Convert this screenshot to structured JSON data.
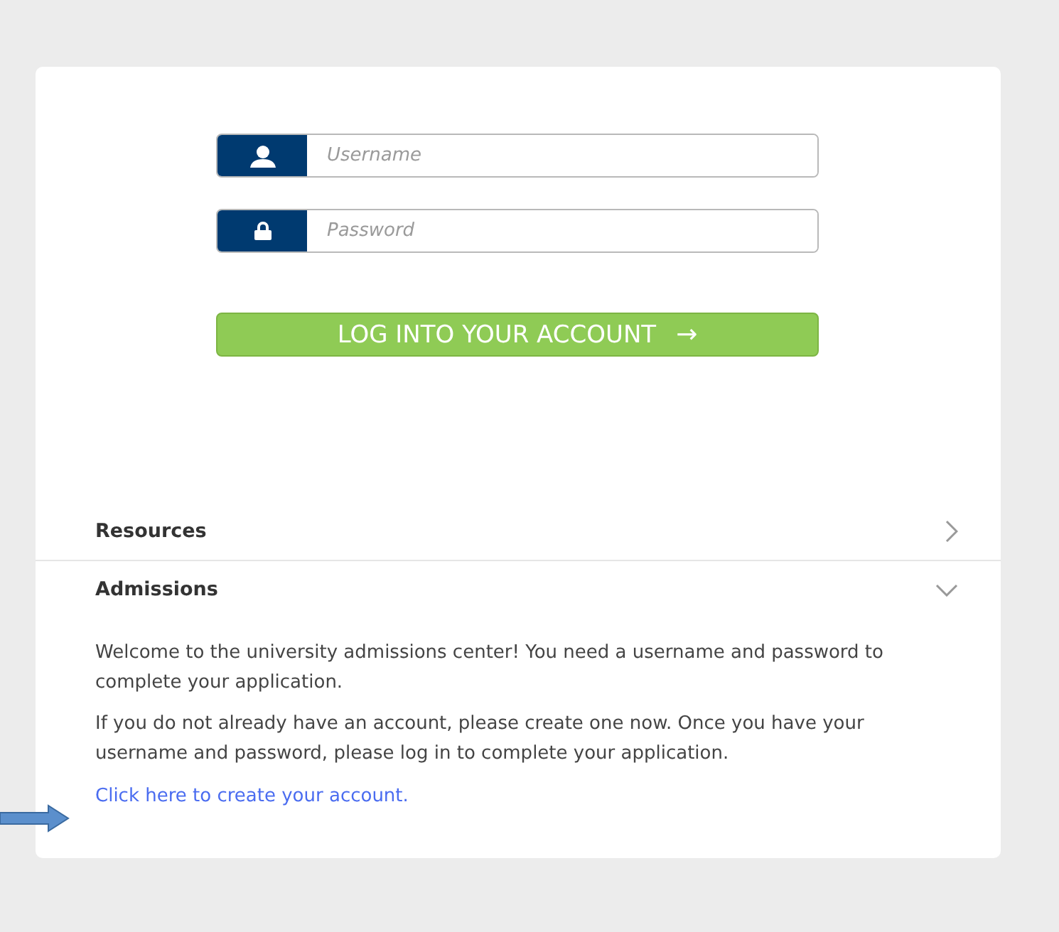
{
  "login": {
    "fields": [
      {
        "kind": "user",
        "placeholder": "Username"
      },
      {
        "kind": "lock",
        "placeholder": "Password"
      }
    ],
    "button": {
      "label": "LOG INTO YOUR ACCOUNT",
      "arrow": "→"
    }
  },
  "sections": [
    {
      "title": "Resources",
      "expanded": false
    },
    {
      "title": "Admissions",
      "expanded": true,
      "paragraphs": [
        "Welcome to the university admissions center! You need a username and password to complete your application.",
        "If you do not already have an account, please create one now. Once you have your username and password, please log in to complete your application."
      ],
      "link": "Click here to create your account."
    }
  ]
}
